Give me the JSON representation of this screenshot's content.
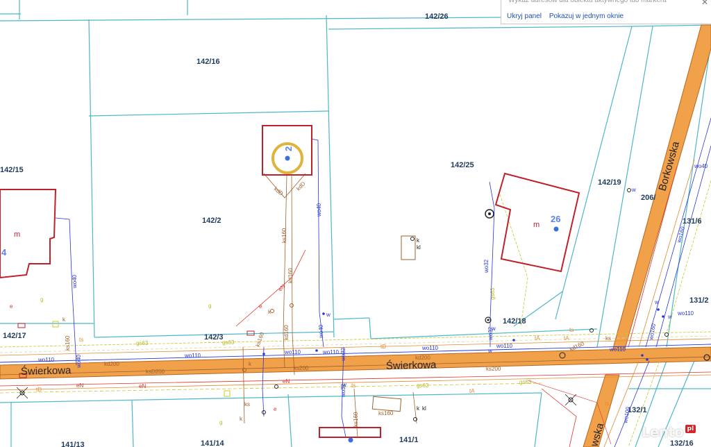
{
  "panel": {
    "header": "Wykaz adresów dla obiektu aktywnego lub markera",
    "hide_label": "Ukryj panel",
    "show_label": "Pokazuj w jednym oknie"
  },
  "parcels": {
    "p142_26": "142/26",
    "p142_16": "142/16",
    "p142_15": "142/15",
    "p142_25": "142/25",
    "p142_2": "142/2",
    "p142_19": "142/19",
    "p206": "206/",
    "p131_6": "131/6",
    "p131_2": "131/2",
    "p142_18": "142/18",
    "p142_17": "142/17",
    "p142_3": "142/3",
    "p141_13": "141/13",
    "p141_14": "141/14",
    "p141_1": "141/1",
    "p132_1": "132/1",
    "p132_16": "132/16"
  },
  "streets": {
    "swierkowa": "Świerkowa",
    "borkowska": "Borkowska",
    "borkowska_partial": "wska"
  },
  "houses": {
    "n2": "2",
    "n26": "26",
    "n4": "4"
  },
  "building_marks": {
    "m": "m"
  },
  "utility_labels": {
    "wo110": "wo110",
    "wo40": "wo40",
    "wo32": "wo32",
    "ks160": "ks160",
    "ks200": "ks200",
    "ksD200": "ksD200",
    "kd200": "kd200",
    "kd160": "kd160",
    "kdD": "kdD",
    "gs63": "gs63",
    "tD": "tD",
    "tA": "tA",
    "ts": "ts",
    "eN": "eN",
    "e": "e",
    "k": "k",
    "kl": "kl",
    "g": "g",
    "w": "w",
    "s": "s",
    "ks": "ks",
    "wo160": "wo160",
    "wo100": "wo100"
  },
  "colors": {
    "road": "#f2a14b",
    "road_edge": "#b8651f",
    "parcel_line": "#4bb7c9",
    "building": "#c0202a",
    "water": "#2835d8",
    "sewer": "#a0602a",
    "gas": "#c8c82a",
    "power": "#e0302a",
    "telecom": "#e08a30",
    "marker": "#e0b43a",
    "point": "#3b6fe0"
  },
  "watermark": {
    "brand": "Lento",
    "tld": "pl"
  }
}
